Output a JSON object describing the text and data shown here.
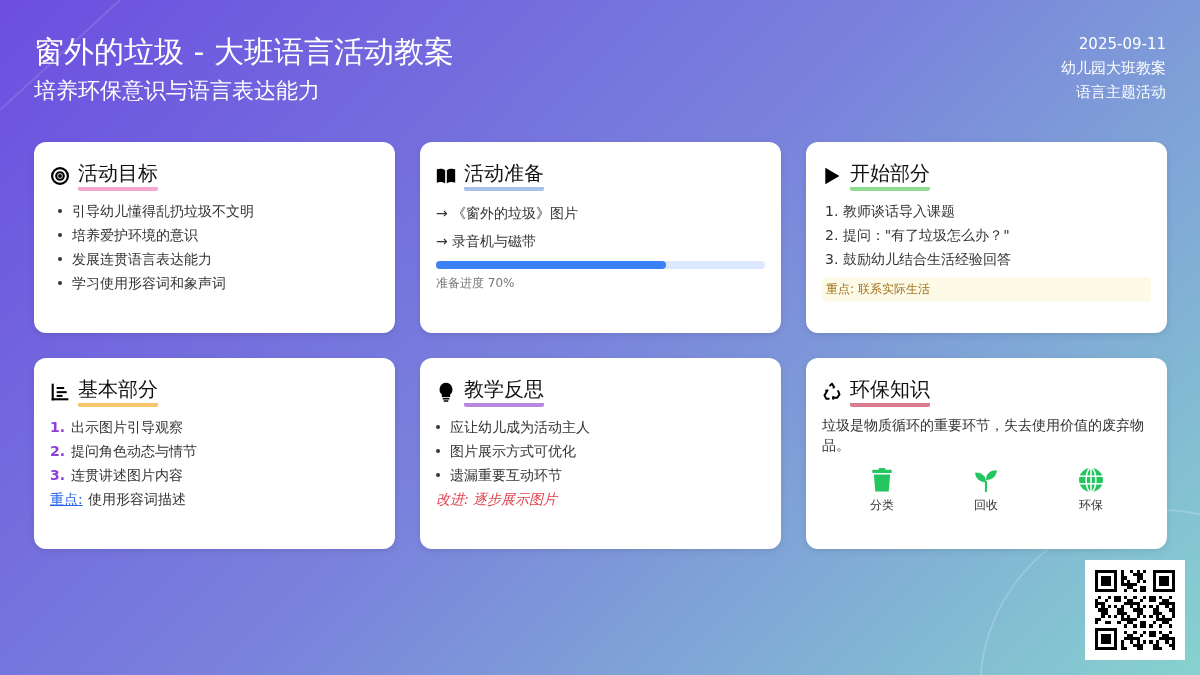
{
  "header": {
    "title": "窗外的垃圾 - 大班语言活动教案",
    "subtitle": "培养环保意识与语言表达能力",
    "meta": [
      "2025-09-11",
      "幼儿园大班教案",
      "语言主题活动"
    ]
  },
  "cards": [
    {
      "kind": "bullets",
      "title": "活动目标",
      "color": "#f4a6cf",
      "items": [
        "引导幼儿懂得乱扔垃圾不文明",
        "培养爱护环境的意识",
        "发展连贯语言表达能力",
        "学习使用形容词和象声词"
      ]
    },
    {
      "kind": "arrows",
      "title": "活动准备",
      "color": "#a9c2ea",
      "items": [
        "→ 《窗外的垃圾》图片",
        "→ 录音机与磁带"
      ],
      "progress": {
        "level": 0.7,
        "label": "准备进度 70%"
      }
    },
    {
      "kind": "numbered",
      "title": "开始部分",
      "color": "#8fdc8f",
      "items": [
        "1. 教师谈话导入课题",
        "2. 提问：\"有了垃圾怎么办？\"",
        "3. 鼓励幼儿结合生活经验回答"
      ],
      "note": "重点: 联系实际生活"
    },
    {
      "kind": "steps",
      "title": "基本部分",
      "color": "#f6c66a",
      "items": [
        {
          "num": "1.",
          "text": "出示图片引导观察"
        },
        {
          "num": "2.",
          "text": "提问角色动态与情节"
        },
        {
          "num": "3.",
          "text": "连贯讲述图片内容"
        }
      ],
      "note": {
        "link": "重点:",
        "text": "使用形容词描述"
      }
    },
    {
      "kind": "reflection",
      "title": "教学反思",
      "color": "#b987e0",
      "items": [
        "应让幼儿成为活动主人",
        "图片展示方式可优化",
        "遗漏重要互动环节"
      ],
      "note": "改进: 逐步展示图片"
    },
    {
      "kind": "knowledge",
      "title": "环保知识",
      "color": "#dc7a90",
      "text": "垃圾是物质循环的重要环节，失去使用价值的废弃物品。",
      "symbols": [
        {
          "label": "分类"
        },
        {
          "label": "回收"
        },
        {
          "label": "环保"
        }
      ]
    }
  ]
}
